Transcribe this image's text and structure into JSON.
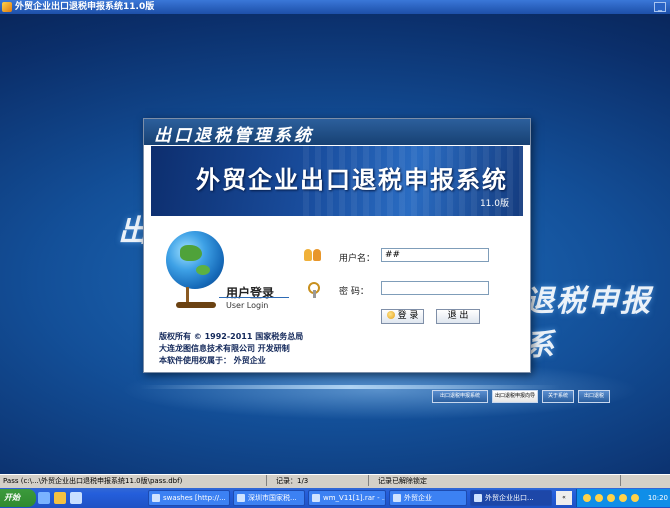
{
  "window": {
    "title": "外贸企业出口退税申报系统11.0版",
    "minimize_glyph": "_"
  },
  "background": {
    "left_text": "出口",
    "right_text": "退税申报系"
  },
  "dialog": {
    "header": "出口退税管理系统",
    "banner_title": "外贸企业出口退税申报系统",
    "banner_version": "11.0版",
    "login_title_cn": "用户登录",
    "login_title_en": "User Login",
    "copyright": "版权所有 © 1992-2011 国家税务总局",
    "developer": "大连龙图信息技术有限公司  开发研制",
    "licensed_to": "本软件使用权属于： 外贸企业",
    "username_label": "用户名：",
    "username_value": "##",
    "password_label": "密   码：",
    "password_value": "",
    "login_button": "登 录",
    "exit_button": "退 出"
  },
  "bottom_buttons": [
    "出口退税申报系统",
    "出口退税申报向导",
    "关于系统",
    "出口退税"
  ],
  "statusbar": {
    "path": "Pass  (c:\\...\\外贸企业出口退税申报系统11.0版\\pass.dbf)",
    "record": "记录：1/3",
    "lock": "记录已解除锁定"
  },
  "taskbar": {
    "start": "开始",
    "tasks": [
      "swashes [http://...",
      "深圳市国家税...",
      "wm_V11[1].rar - ...",
      "外贸企业",
      "外贸企业出口..."
    ],
    "lang": "«",
    "clock": "10:20"
  }
}
